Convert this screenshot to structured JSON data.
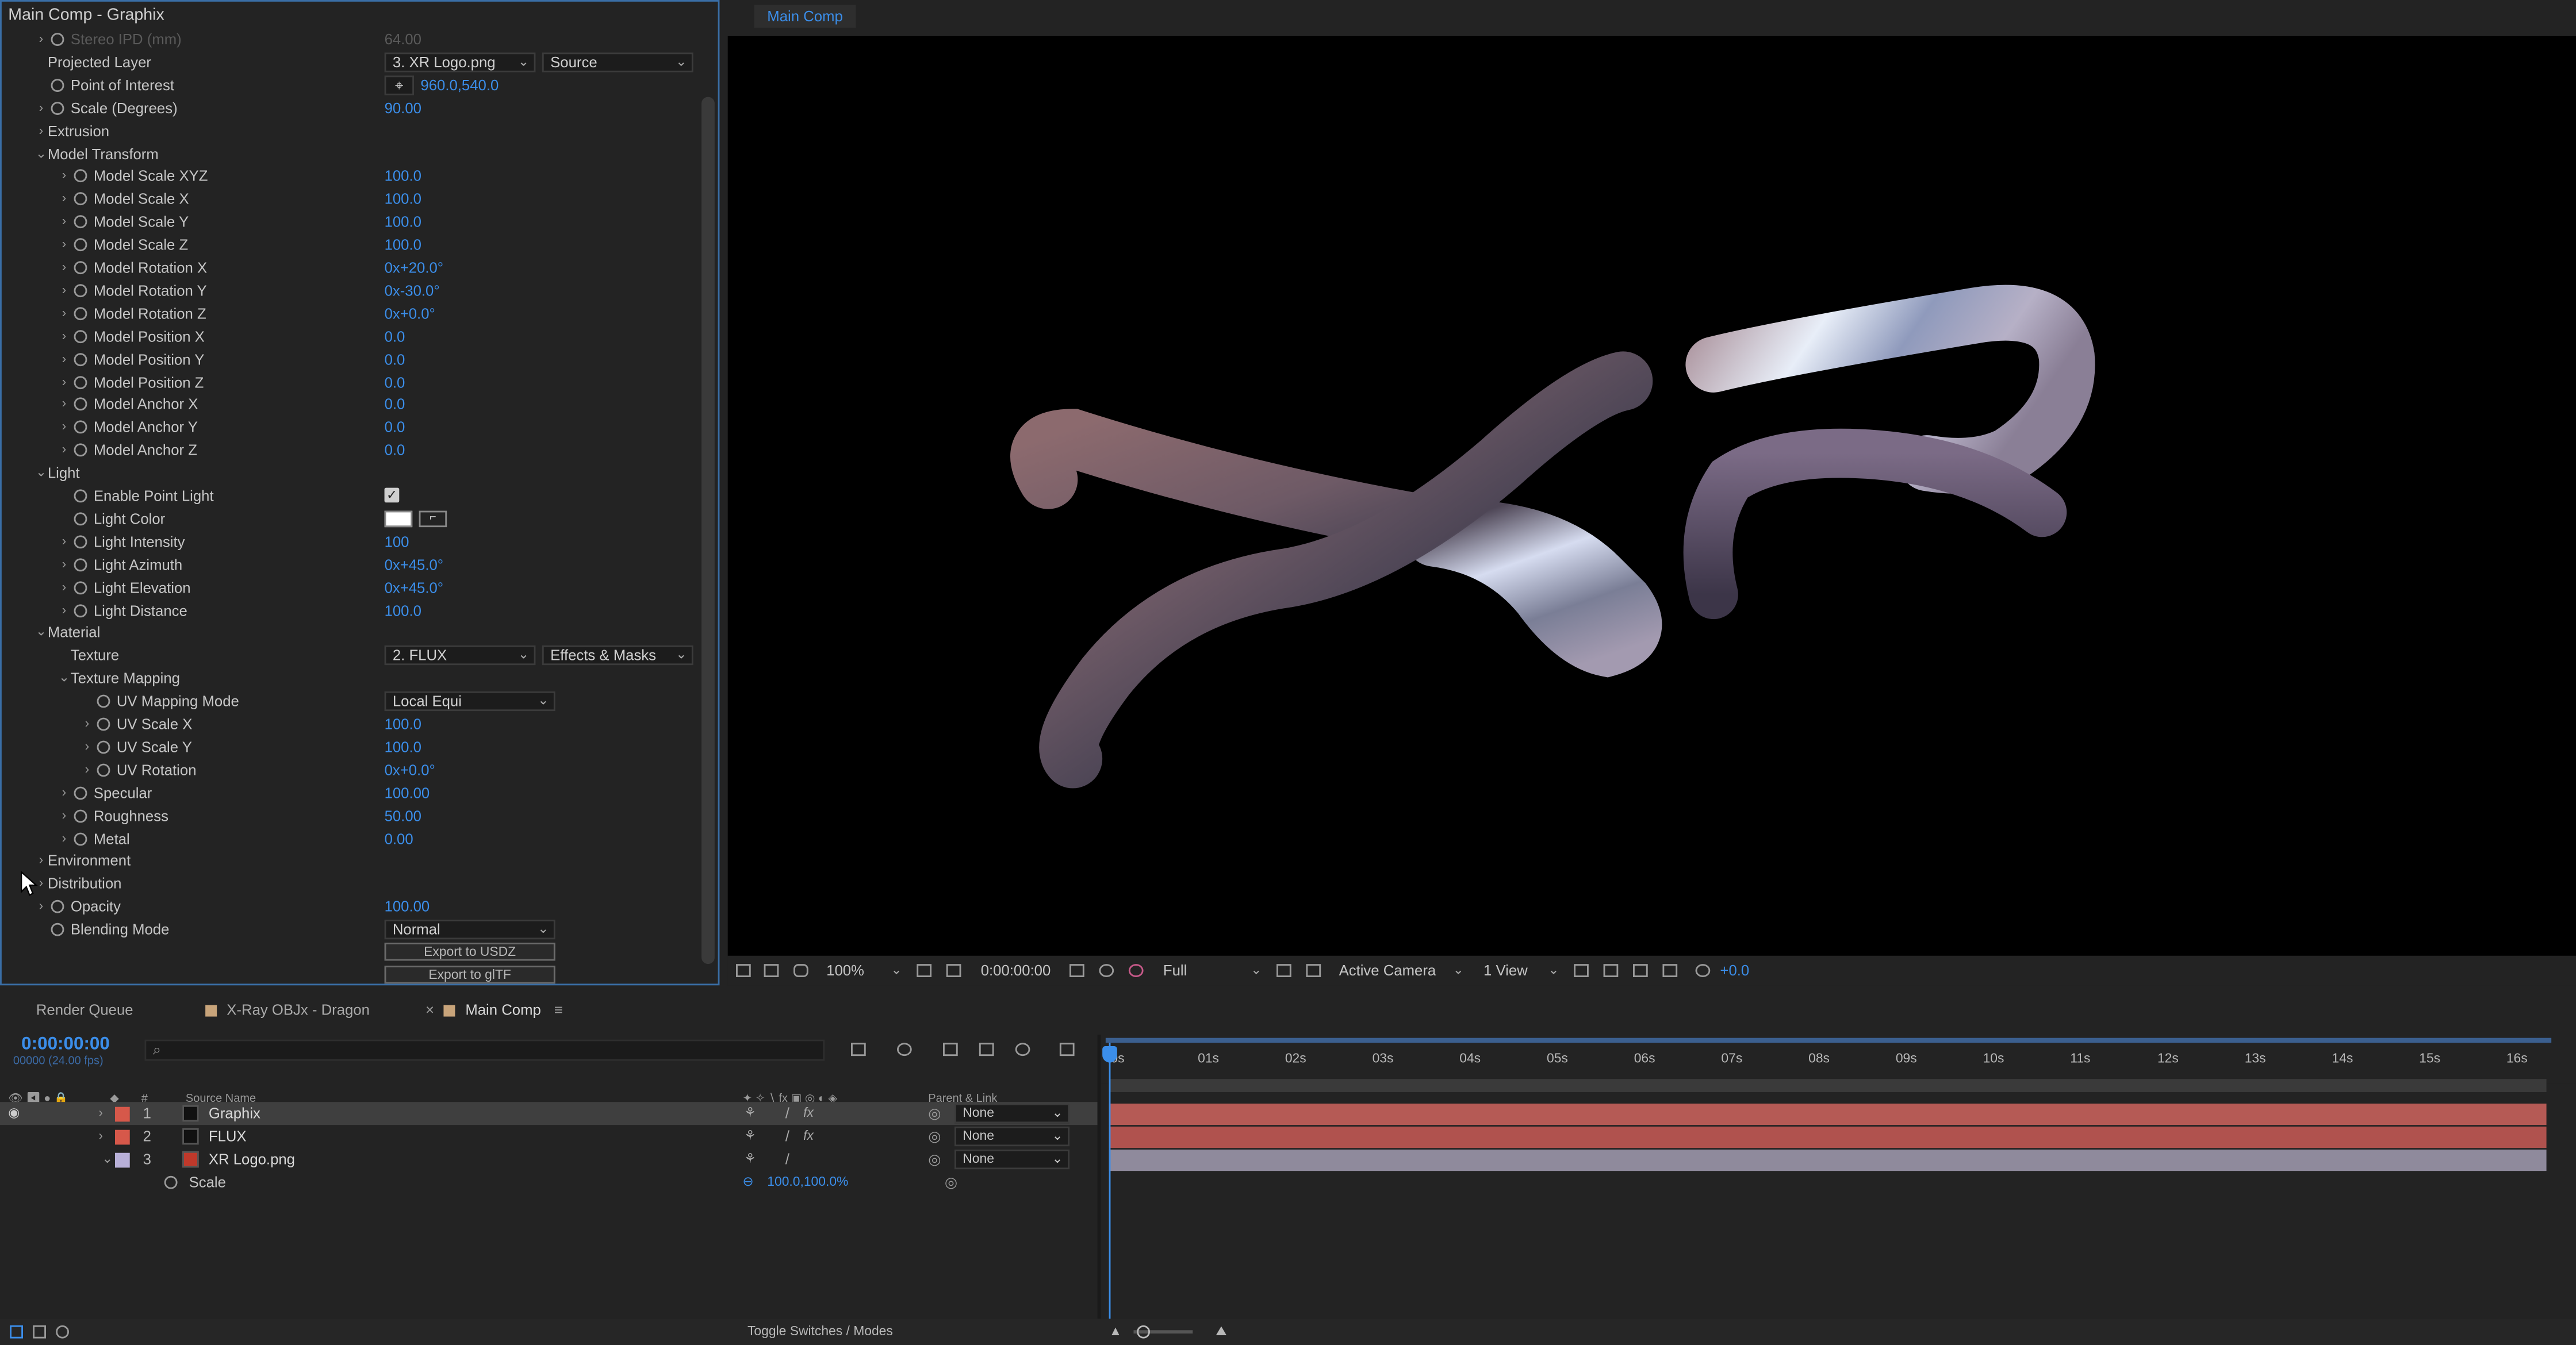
{
  "effect_controls": {
    "title": "Main Comp - Graphix",
    "rows": [
      {
        "indent": 1,
        "arrow": "›",
        "stopwatch": true,
        "label": "Stereo IPD (mm)",
        "value": "64.00",
        "dim": true
      },
      {
        "indent": 1,
        "arrow": "",
        "stopwatch": false,
        "label": "Projected Layer",
        "dropdowns": [
          "3. XR Logo.png",
          "Source"
        ]
      },
      {
        "indent": 1,
        "arrow": "",
        "stopwatch": true,
        "label": "Point of Interest",
        "value": "960.0,540.0",
        "crosshair": true
      },
      {
        "indent": 1,
        "arrow": "›",
        "stopwatch": true,
        "label": "Scale (Degrees)",
        "value": "90.00"
      },
      {
        "indent": 1,
        "arrow": "›",
        "stopwatch": false,
        "label": "Extrusion"
      },
      {
        "indent": 1,
        "arrow": "⌄",
        "stopwatch": false,
        "label": "Model Transform"
      },
      {
        "indent": 2,
        "arrow": "›",
        "stopwatch": true,
        "label": "Model Scale XYZ",
        "value": "100.0"
      },
      {
        "indent": 2,
        "arrow": "›",
        "stopwatch": true,
        "label": "Model Scale X",
        "value": "100.0"
      },
      {
        "indent": 2,
        "arrow": "›",
        "stopwatch": true,
        "label": "Model Scale Y",
        "value": "100.0"
      },
      {
        "indent": 2,
        "arrow": "›",
        "stopwatch": true,
        "label": "Model Scale Z",
        "value": "100.0"
      },
      {
        "indent": 2,
        "arrow": "›",
        "stopwatch": true,
        "label": "Model Rotation X",
        "value": "0x+20.0°"
      },
      {
        "indent": 2,
        "arrow": "›",
        "stopwatch": true,
        "label": "Model Rotation Y",
        "value": "0x-30.0°"
      },
      {
        "indent": 2,
        "arrow": "›",
        "stopwatch": true,
        "label": "Model Rotation Z",
        "value": "0x+0.0°"
      },
      {
        "indent": 2,
        "arrow": "›",
        "stopwatch": true,
        "label": "Model Position X",
        "value": "0.0"
      },
      {
        "indent": 2,
        "arrow": "›",
        "stopwatch": true,
        "label": "Model Position Y",
        "value": "0.0"
      },
      {
        "indent": 2,
        "arrow": "›",
        "stopwatch": true,
        "label": "Model Position Z",
        "value": "0.0"
      },
      {
        "indent": 2,
        "arrow": "›",
        "stopwatch": true,
        "label": "Model Anchor X",
        "value": "0.0"
      },
      {
        "indent": 2,
        "arrow": "›",
        "stopwatch": true,
        "label": "Model Anchor Y",
        "value": "0.0"
      },
      {
        "indent": 2,
        "arrow": "›",
        "stopwatch": true,
        "label": "Model Anchor Z",
        "value": "0.0"
      },
      {
        "indent": 1,
        "arrow": "⌄",
        "stopwatch": false,
        "label": "Light"
      },
      {
        "indent": 2,
        "arrow": "",
        "stopwatch": true,
        "label": "Enable Point Light",
        "checkbox": true
      },
      {
        "indent": 2,
        "arrow": "",
        "stopwatch": true,
        "label": "Light Color",
        "swatch": "#ffffff"
      },
      {
        "indent": 2,
        "arrow": "›",
        "stopwatch": true,
        "label": "Light Intensity",
        "value": "100"
      },
      {
        "indent": 2,
        "arrow": "›",
        "stopwatch": true,
        "label": "Light Azimuth",
        "value": "0x+45.0°"
      },
      {
        "indent": 2,
        "arrow": "›",
        "stopwatch": true,
        "label": "Light Elevation",
        "value": "0x+45.0°"
      },
      {
        "indent": 2,
        "arrow": "›",
        "stopwatch": true,
        "label": "Light Distance",
        "value": "100.0"
      },
      {
        "indent": 1,
        "arrow": "⌄",
        "stopwatch": false,
        "label": "Material"
      },
      {
        "indent": 2,
        "arrow": "",
        "stopwatch": false,
        "label": "Texture",
        "dropdowns": [
          "2. FLUX",
          "Effects & Masks"
        ]
      },
      {
        "indent": 2,
        "arrow": "⌄",
        "stopwatch": false,
        "label": "Texture Mapping"
      },
      {
        "indent": 3,
        "arrow": "",
        "stopwatch": true,
        "label": "UV Mapping Mode",
        "dropdowns": [
          "Local Equi"
        ]
      },
      {
        "indent": 3,
        "arrow": "›",
        "stopwatch": true,
        "label": "UV Scale X",
        "value": "100.0"
      },
      {
        "indent": 3,
        "arrow": "›",
        "stopwatch": true,
        "label": "UV Scale Y",
        "value": "100.0"
      },
      {
        "indent": 3,
        "arrow": "›",
        "stopwatch": true,
        "label": "UV Rotation",
        "value": "0x+0.0°"
      },
      {
        "indent": 2,
        "arrow": "›",
        "stopwatch": true,
        "label": "Specular",
        "value": "100.00"
      },
      {
        "indent": 2,
        "arrow": "›",
        "stopwatch": true,
        "label": "Roughness",
        "value": "50.00"
      },
      {
        "indent": 2,
        "arrow": "›",
        "stopwatch": true,
        "label": "Metal",
        "value": "0.00"
      },
      {
        "indent": 1,
        "arrow": "›",
        "stopwatch": false,
        "label": "Environment"
      },
      {
        "indent": 1,
        "arrow": "›",
        "stopwatch": false,
        "label": "Distribution"
      },
      {
        "indent": 1,
        "arrow": "›",
        "stopwatch": true,
        "label": "Opacity",
        "value": "100.00"
      },
      {
        "indent": 1,
        "arrow": "",
        "stopwatch": true,
        "label": "Blending Mode",
        "dropdowns": [
          "Normal"
        ]
      }
    ],
    "buttons": {
      "export_usdz": "Export to USDZ",
      "export_gltf": "Export to glTF"
    }
  },
  "viewer": {
    "tab": "Main Comp",
    "zoom": "100%",
    "timecode": "0:00:00:00",
    "resolution": "Full",
    "camera": "Active Camera",
    "views": "1 View",
    "exposure": "+0.0"
  },
  "timeline": {
    "tabs": {
      "render_queue": "Render Queue",
      "xray": "X-Ray OBJx - Dragon",
      "main": "Main Comp"
    },
    "timecode": "0:00:00:00",
    "fps": "00000 (24.00 fps)",
    "headers": {
      "num": "#",
      "source": "Source Name",
      "parent": "Parent & Link"
    },
    "ruler": [
      "0s",
      "01s",
      "02s",
      "03s",
      "04s",
      "05s",
      "06s",
      "07s",
      "08s",
      "09s",
      "10s",
      "11s",
      "12s",
      "13s",
      "14s",
      "15s",
      "16s"
    ],
    "layers": [
      {
        "num": "1",
        "name": "Graphix",
        "label_color": "#d6584a",
        "parent": "None",
        "selected": true
      },
      {
        "num": "2",
        "name": "FLUX",
        "label_color": "#d6584a",
        "parent": "None",
        "selected": false
      },
      {
        "num": "3",
        "name": "XR Logo.png",
        "label_color": "#b8b0d8",
        "parent": "None",
        "selected": false
      }
    ],
    "scale_prop": {
      "label": "Scale",
      "value": "100.0,100.0%"
    },
    "bottom": {
      "toggle": "Toggle Switches / Modes"
    }
  },
  "colors": {
    "accent": "#3b8eea",
    "bar_red": "#b55a55",
    "bar_lavender": "#8f8a9c"
  }
}
